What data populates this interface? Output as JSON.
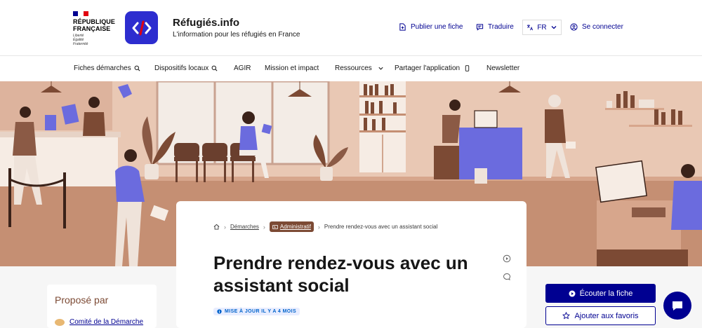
{
  "colors": {
    "primary": "#000091",
    "logo_blue": "#2d2dcf",
    "hero_bg": "#e9c8b4",
    "brand_brown": "#7c4a34",
    "badge_bg": "#e8edff",
    "badge_text": "#0063cb"
  },
  "gov_logo": {
    "line1": "RÉPUBLIQUE",
    "line2": "FRANÇAISE",
    "devise": [
      "Liberté",
      "Égalité",
      "Fraternité"
    ]
  },
  "brand": {
    "title": "Réfugiés.info",
    "tagline": "L'information pour les réfugiés en France",
    "logo_icon": "code-brackets-icon"
  },
  "tools": {
    "publish": {
      "label": "Publier une fiche",
      "icon": "document-plus-icon"
    },
    "translate": {
      "label": "Traduire",
      "icon": "chat-icon"
    },
    "language": {
      "label": "FR",
      "icon": "translate-icon"
    },
    "login": {
      "label": "Se connecter",
      "icon": "user-icon"
    }
  },
  "nav": {
    "items": [
      {
        "label": "Fiches démarches",
        "icon": "search-icon"
      },
      {
        "label": "Dispositifs locaux",
        "icon": "search-icon"
      },
      {
        "label": "AGIR",
        "icon": ""
      },
      {
        "label": "Mission et impact",
        "icon": ""
      },
      {
        "label": "Ressources",
        "icon": "chevron-down-icon"
      },
      {
        "label": "Partager l'application",
        "icon": "phone-icon"
      },
      {
        "label": "Newsletter",
        "icon": ""
      }
    ]
  },
  "breadcrumb": {
    "items": [
      "Démarches",
      "Administratif",
      "Prendre rendez-vous avec un assistant social"
    ]
  },
  "page": {
    "title": "Prendre rendez-vous avec un assistant social",
    "updated": "MISE À JOUR IL Y A 4 MOIS"
  },
  "sidebar": {
    "title": "Proposé par",
    "item": "Comité de la Démarche"
  },
  "actions": {
    "listen": "Écouter la fiche",
    "favorite": "Ajouter aux favoris"
  }
}
